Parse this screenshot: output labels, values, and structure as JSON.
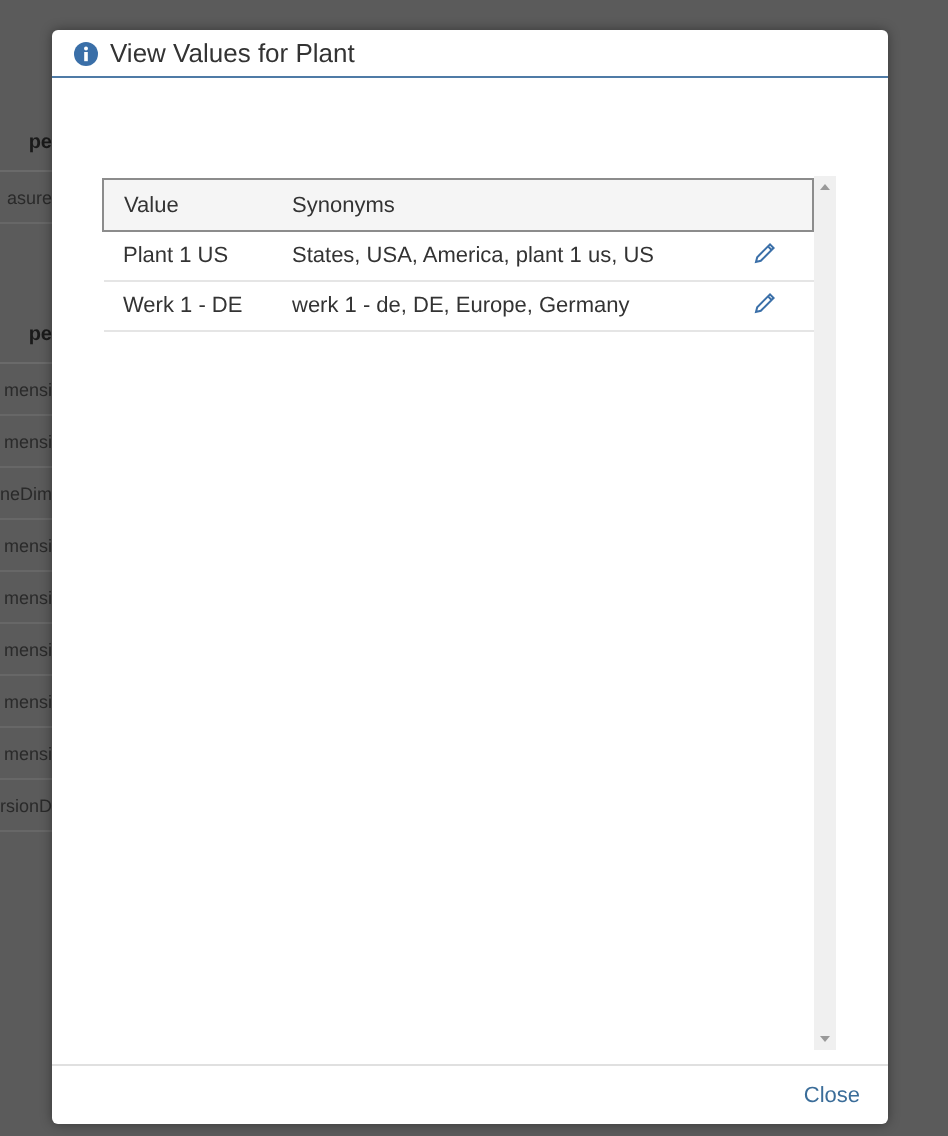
{
  "background": {
    "sections": [
      {
        "header": "pe",
        "rows": [
          "asure"
        ]
      },
      {
        "header": "pe",
        "rows": [
          "mensi",
          "mensi",
          "neDim",
          "mensi",
          "mensi",
          "mensi",
          "mensi",
          "mensi",
          "rsionD"
        ]
      }
    ]
  },
  "dialog": {
    "title": "View Values for Plant",
    "table": {
      "columns": [
        "Value",
        "Synonyms"
      ],
      "rows": [
        {
          "value": "Plant 1 US",
          "synonyms": "States, USA, America, plant 1 us, US"
        },
        {
          "value": "Werk 1 - DE",
          "synonyms": "werk 1 - de, DE, Europe, Germany"
        }
      ]
    },
    "buttons": [
      "Close"
    ]
  }
}
